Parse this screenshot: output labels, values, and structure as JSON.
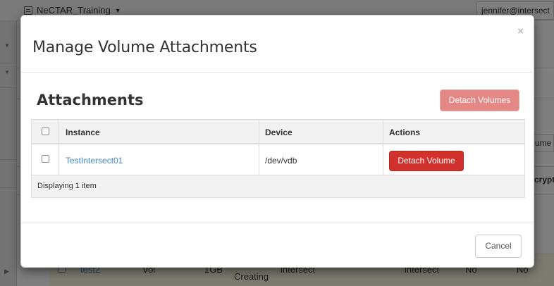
{
  "background": {
    "project_name": "NeCTAR_Training",
    "user_name": "jennifer@intersect",
    "right_input_text": "ume",
    "right_header_text": "crypted",
    "row": {
      "name": "test2",
      "description": "Vol",
      "size": "1GB",
      "status": "Creating",
      "type": "intersect",
      "az": "intersect",
      "bootable": "No",
      "encrypted": "No"
    }
  },
  "modal": {
    "title": "Manage Volume Attachments",
    "close_symbol": "×",
    "section_title": "Attachments",
    "detach_volumes_label": "Detach Volumes",
    "table": {
      "headers": [
        "Instance",
        "Device",
        "Actions"
      ],
      "rows": [
        {
          "instance": "TestIntersect01",
          "device": "/dev/vdb",
          "action_label": "Detach Volume"
        }
      ],
      "footer": "Displaying 1 item"
    },
    "cancel_label": "Cancel"
  },
  "colors": {
    "link": "#428bca",
    "danger": "#d2322d",
    "danger_disabled": "#e48886",
    "highlight_row": "#fcf8e3"
  }
}
